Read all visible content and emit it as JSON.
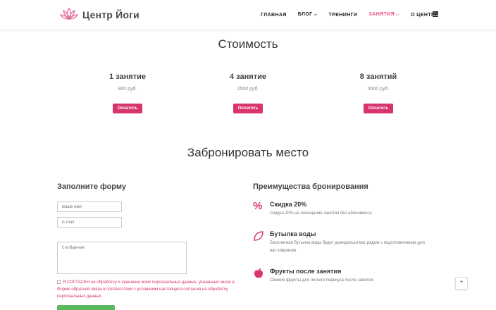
{
  "header": {
    "logo_text": "Центр Йоги",
    "nav": [
      {
        "label": "ГЛАВНАЯ",
        "dropdown": false,
        "active": false
      },
      {
        "label": "БЛОГ",
        "dropdown": true,
        "active": false
      },
      {
        "label": "ТРЕНИНГИ",
        "dropdown": false,
        "active": false
      },
      {
        "label": "ЗАНЯТИЯ",
        "dropdown": true,
        "active": true
      },
      {
        "label": "О ЦЕНТРЕ",
        "dropdown": false,
        "active": false
      }
    ]
  },
  "pricing": {
    "title": "Стоимость",
    "plans": [
      {
        "name": "1 занятие",
        "price": "800 руб.",
        "button": "Оплатить"
      },
      {
        "name": "4 занятие",
        "price": "2500 руб.",
        "button": "Оплатить"
      },
      {
        "name": "8 занятий",
        "price": "4500 руб.",
        "button": "Оплатить"
      }
    ]
  },
  "booking": {
    "title": "Забронировать место",
    "form": {
      "heading": "Заполните форму",
      "name_placeholder": "Ваше имя",
      "email_placeholder": "E-mail",
      "message_placeholder": "Сообщение",
      "agreement": "Я СОГЛАСЕН на обработку и хранение моих персональных данных, указанных мною в Форме обратной связи в соответствии с условиями настоящего согласия на обработку персональных данных."
    },
    "benefits": {
      "heading": "Преимущества бронирования",
      "items": [
        {
          "title": "Скидка 20%",
          "desc": "Скидка 20% на посещение занятия без абонемента",
          "icon": "percent-icon"
        },
        {
          "title": "Бутылка воды",
          "desc": "Бесплатная бутылка воды будет дожидаться вас рядом с подготовленным для вас ковриком.",
          "icon": "leaf-icon"
        },
        {
          "title": "Фрукты после занятия",
          "desc": "Свежие фрукты для легкого перекуса после занятия.",
          "icon": "apple-icon"
        }
      ]
    }
  },
  "colors": {
    "accent": "#d8356f",
    "nav_active": "#e84f8a",
    "submit": "#5cb85c"
  }
}
